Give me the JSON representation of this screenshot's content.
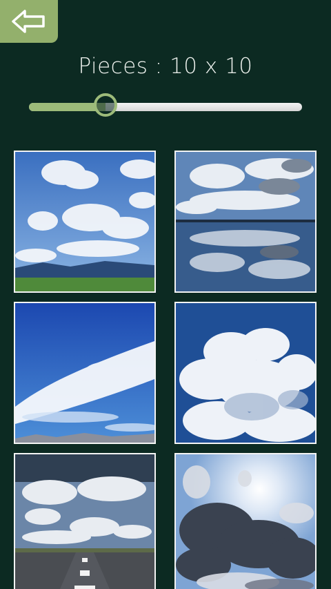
{
  "header": {
    "back_icon": "arrow-left-icon",
    "pieces_text": "Pieces : 10 x 10"
  },
  "slider": {
    "value": 10,
    "fraction": 0.28
  },
  "colors": {
    "background": "#0c2a22",
    "accent": "#9dbb7a",
    "button": "#93b06c"
  },
  "gallery": {
    "images": [
      {
        "subject": "blue sky with white clouds over mountains and green field"
      },
      {
        "subject": "clouds reflected in calm lake"
      },
      {
        "subject": "white wispy cloud on deep blue sky above mountains"
      },
      {
        "subject": "large cumulus cloud on blue sky"
      },
      {
        "subject": "stormy clouds over straight road"
      },
      {
        "subject": "dark cloud with sun behind"
      }
    ]
  }
}
